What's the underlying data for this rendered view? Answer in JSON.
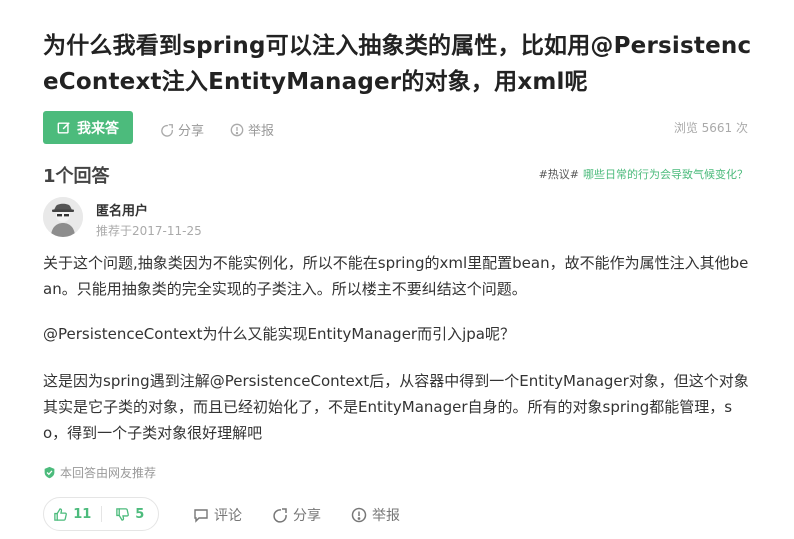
{
  "question": {
    "title": "为什么我看到spring可以注入抽象类的属性，比如用@PersistenceContext注入EntityManager的对象，用xml呢",
    "answer_button": "我来答",
    "share": "分享",
    "report": "举报",
    "views": "浏览 5661 次"
  },
  "answers_header": {
    "count": "1个回答",
    "hot_tag": "#热议#",
    "hot_link": "哪些日常的行为会导致气候变化？"
  },
  "answer": {
    "username": "匿名用户",
    "recommended_date": "推荐于2017-11-25",
    "paragraphs": [
      "关于这个问题,抽象类因为不能实例化，所以不能在spring的xml里配置bean，故不能作为属性注入其他bean。只能用抽象类的完全实现的子类注入。所以楼主不要纠结这个问题。",
      "@PersistenceContext为什么又能实现EntityManager而引入jpa呢？",
      "这是因为spring遇到注解@PersistenceContext后，从容器中得到一个EntityManager对象，但这个对象其实是它子类的对象，而且已经初始化了，不是EntityManager自身的。所有的对象spring都能管理，so，得到一个子类对象很好理解吧"
    ],
    "recommended_note": "本回答由网友推荐",
    "upvotes": "11",
    "downvotes": "5",
    "comment": "评论",
    "share": "分享",
    "report": "举报"
  },
  "icons": {
    "answer": "edit-icon",
    "share": "share-icon",
    "report": "report-icon",
    "shield": "shield-check-icon",
    "up": "thumbs-up-icon",
    "down": "thumbs-down-icon",
    "comment": "comment-icon"
  },
  "colors": {
    "accent": "#4cbb7c"
  }
}
